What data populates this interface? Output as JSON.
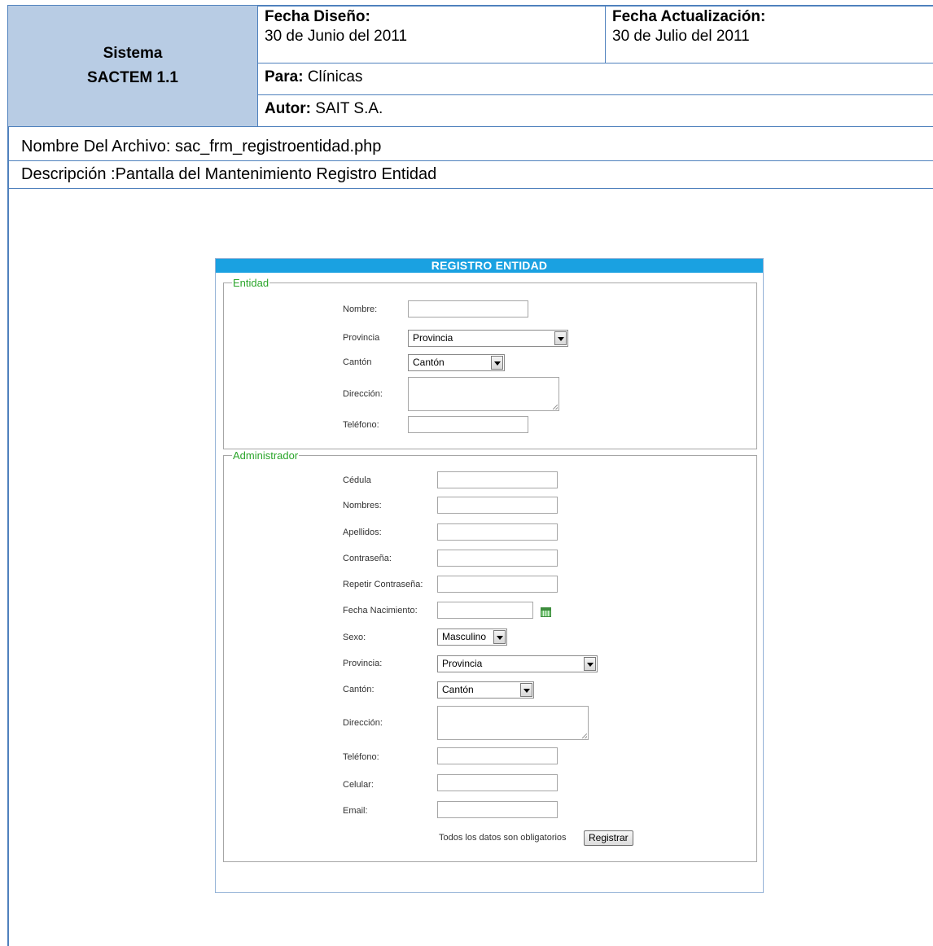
{
  "header": {
    "system_line1": "Sistema",
    "system_line2": "SACTEM 1.1",
    "design_date_label": "Fecha Diseño:",
    "design_date": "30 de Junio del 2011",
    "update_date_label": "Fecha Actualización:",
    "update_date": "30 de Julio del 2011",
    "for_label": "Para:",
    "for_value": "Clínicas",
    "author_label": "Autor:",
    "author_value": "SAIT S.A."
  },
  "file_name": "Nombre Del Archivo: sac_frm_registroentidad.php",
  "description": "Descripción :Pantalla del Mantenimiento Registro Entidad",
  "form": {
    "title": "REGISTRO ENTIDAD",
    "entidad": {
      "legend": "Entidad",
      "nombre_label": "Nombre:",
      "provincia_label": "Provincia",
      "provincia_value": "Provincia",
      "canton_label": "Cantón",
      "canton_value": "Cantón",
      "direccion_label": "Dirección:",
      "telefono_label": "Teléfono:"
    },
    "administrador": {
      "legend": "Administrador",
      "cedula_label": "Cédula",
      "nombres_label": "Nombres:",
      "apellidos_label": "Apellidos:",
      "contrasena_label": "Contraseña:",
      "repetir_label": "Repetir Contraseña:",
      "fecha_label": "Fecha Nacimiento:",
      "sexo_label": "Sexo:",
      "sexo_value": "Masculino",
      "provincia_label": "Provincia:",
      "provincia_value": "Provincia",
      "canton_label": "Cantón:",
      "canton_value": "Cantón",
      "direccion_label": "Dirección:",
      "telefono_label": "Teléfono:",
      "celular_label": "Celular:",
      "email_label": "Email:"
    },
    "required_note": "Todos los datos son obligatorios",
    "submit_label": "Registrar"
  }
}
